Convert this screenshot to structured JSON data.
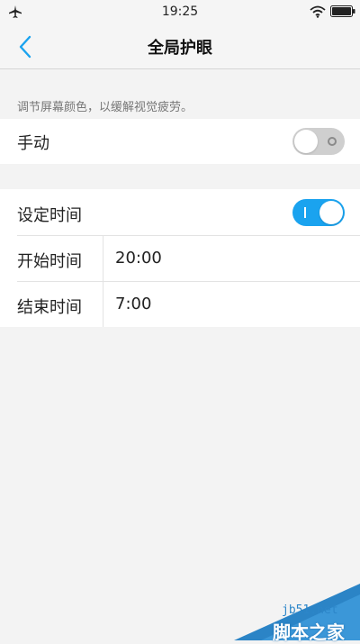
{
  "status_bar": {
    "time": "19:25",
    "left_icon": "airplane-icon",
    "right_icons": [
      "wifi-icon",
      "battery-icon"
    ]
  },
  "nav": {
    "title": "全局护眼",
    "back_icon": "chevron-left-icon"
  },
  "description": "调节屏幕颜色，以缓解视觉疲劳。",
  "manual": {
    "label": "手动",
    "enabled": false
  },
  "schedule": {
    "label": "设定时间",
    "enabled": true,
    "start": {
      "label": "开始时间",
      "value": "20:00"
    },
    "end": {
      "label": "结束时间",
      "value": "7:00"
    }
  },
  "watermark": {
    "url": "jb51.net",
    "brand": "脚本之家"
  },
  "colors": {
    "accent": "#1aa3ef",
    "background": "#f3f3f3",
    "card": "#ffffff",
    "toggle_off": "#cfcfcf"
  }
}
